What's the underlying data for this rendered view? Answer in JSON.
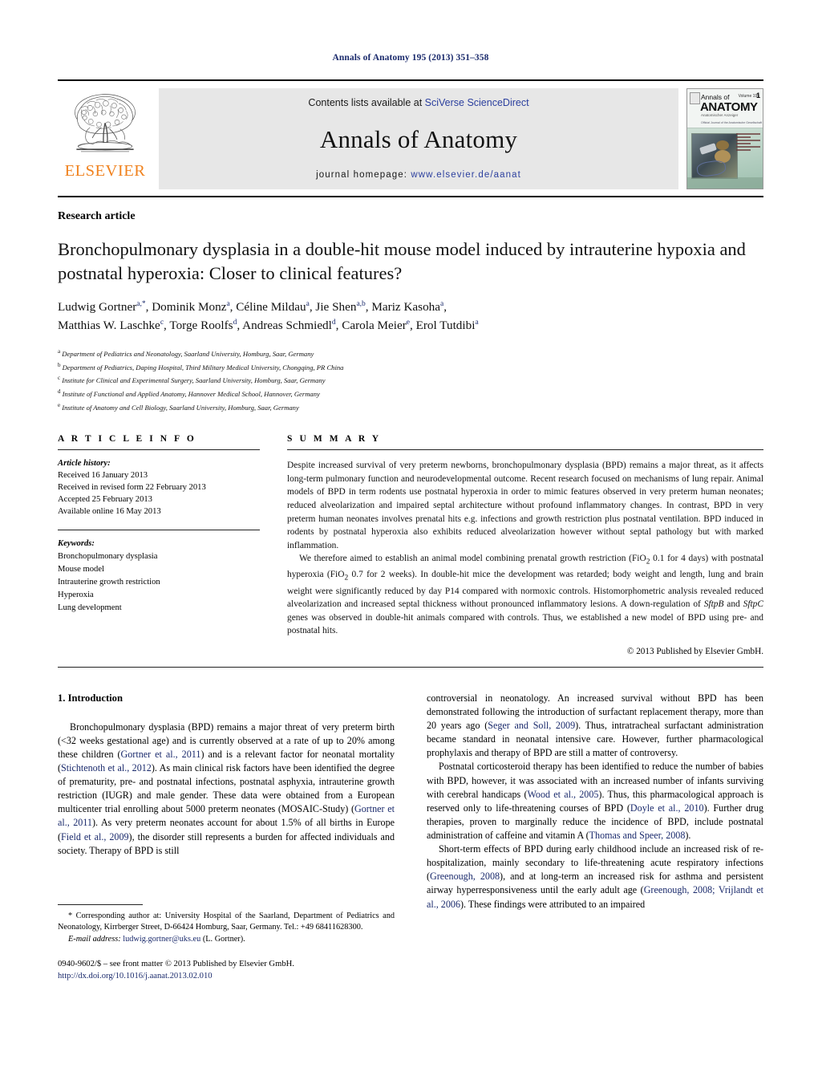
{
  "running_head": "Annals of Anatomy 195 (2013) 351–358",
  "masthead": {
    "publisher_logo_text": "ELSEVIER",
    "contents_prefix": "Contents lists available at ",
    "contents_link": "SciVerse ScienceDirect",
    "journal_title": "Annals of Anatomy",
    "homepage_label": "journal homepage: ",
    "homepage_url": "www.elsevier.de/aanat",
    "cover": {
      "line_annals": "Annals of",
      "line_anatomy": "ANATOMY",
      "volume_label": "Volume 195",
      "issue_number": "1",
      "subtitle": "Anatomischer Anzeiger",
      "tagline": "Official Journal of the Anatomische Gesellschaft"
    }
  },
  "article": {
    "type": "Research article",
    "title": "Bronchopulmonary dysplasia in a double-hit mouse model induced by intrauterine hypoxia and postnatal hyperoxia: Closer to clinical features?",
    "authors_line1": "Ludwig Gortner",
    "authors": "Ludwig Gortner a,*, Dominik Monz a, Céline Mildau a, Jie Shen a,b, Mariz Kasoha a, Matthias W. Laschke c, Torge Roolfs d, Andreas Schmiedl d, Carola Meier e, Erol Tutdibi a",
    "affiliations": [
      {
        "marker": "a",
        "text": "Department of Pediatrics and Neonatology, Saarland University, Homburg, Saar, Germany"
      },
      {
        "marker": "b",
        "text": "Department of Pediatrics, Daping Hospital, Third Military Medical University, Chongqing, PR China"
      },
      {
        "marker": "c",
        "text": "Institute for Clinical and Experimental Surgery, Saarland University, Homburg, Saar, Germany"
      },
      {
        "marker": "d",
        "text": "Institute of Functional and Applied Anatomy, Hannover Medical School, Hannover, Germany"
      },
      {
        "marker": "e",
        "text": "Institute of Anatomy and Cell Biology, Saarland University, Homburg, Saar, Germany"
      }
    ]
  },
  "article_info": {
    "heading": "A R T I C L E   I N F O",
    "history_label": "Article history:",
    "history": [
      "Received 16 January 2013",
      "Received in revised form 22 February 2013",
      "Accepted 25 February 2013",
      "Available online 16 May 2013"
    ],
    "keywords_label": "Keywords:",
    "keywords": [
      "Bronchopulmonary dysplasia",
      "Mouse model",
      "Intrauterine growth restriction",
      "Hyperoxia",
      "Lung development"
    ]
  },
  "summary": {
    "heading": "S U M M A R Y",
    "paragraph1": "Despite increased survival of very preterm newborns, bronchopulmonary dysplasia (BPD) remains a major threat, as it affects long-term pulmonary function and neurodevelopmental outcome. Recent research focused on mechanisms of lung repair. Animal models of BPD in term rodents use postnatal hyperoxia in order to mimic features observed in very preterm human neonates; reduced alveolarization and impaired septal architecture without profound inflammatory changes. In contrast, BPD in very preterm human neonates involves prenatal hits e.g. infections and growth restriction plus postnatal ventilation. BPD induced in rodents by postnatal hyperoxia also exhibits reduced alveolarization however without septal pathology but with marked inflammation.",
    "paragraph2": "We therefore aimed to establish an animal model combining prenatal growth restriction (FiO2 0.1 for 4 days) with postnatal hyperoxia (FiO2 0.7 for 2 weeks). In double-hit mice the development was retarded; body weight and length, lung and brain weight were significantly reduced by day P14 compared with normoxic controls. Histomorphometric analysis revealed reduced alveolarization and increased septal thickness without pronounced inflammatory lesions. A down-regulation of SftpB and SftpC genes was observed in double-hit animals compared with controls. Thus, we established a new model of BPD using pre- and postnatal hits.",
    "copyright": "© 2013 Published by Elsevier GmbH."
  },
  "body": {
    "section_number_title": "1.  Introduction",
    "left_paragraph": "Bronchopulmonary dysplasia (BPD) remains a major threat of very preterm birth (<32 weeks gestational age) and is currently observed at a rate of up to 20% among these children (Gortner et al., 2011) and is a relevant factor for neonatal mortality (Stichtenoth et al., 2012). As main clinical risk factors have been identified the degree of prematurity, pre- and postnatal infections, postnatal asphyxia, intrauterine growth restriction (IUGR) and male gender. These data were obtained from a European multicenter trial enrolling about 5000 preterm neonates (MOSAIC-Study) (Gortner et al., 2011). As very preterm neonates account for about 1.5% of all births in Europe (Field et al., 2009), the disorder still represents a burden for affected individuals and society. Therapy of BPD is still",
    "right_paragraph1": "controversial in neonatology. An increased survival without BPD has been demonstrated following the introduction of surfactant replacement therapy, more than 20 years ago (Seger and Soll, 2009). Thus, intratracheal surfactant administration became standard in neonatal intensive care. However, further pharmacological prophylaxis and therapy of BPD are still a matter of controversy.",
    "right_paragraph2": "Postnatal corticosteroid therapy has been identified to reduce the number of babies with BPD, however, it was associated with an increased number of infants surviving with cerebral handicaps (Wood et al., 2005). Thus, this pharmacological approach is reserved only to life-threatening courses of BPD (Doyle et al., 2010). Further drug therapies, proven to marginally reduce the incidence of BPD, include postnatal administration of caffeine and vitamin A (Thomas and Speer, 2008).",
    "right_paragraph3": "Short-term effects of BPD during early childhood include an increased risk of re-hospitalization, mainly secondary to life-threatening acute respiratory infections (Greenough, 2008), and at long-term an increased risk for asthma and persistent airway hyperresponsiveness until the early adult age (Greenough, 2008; Vrijlandt et al., 2006). These findings were attributed to an impaired"
  },
  "footnote": {
    "corresponding": "* Corresponding author at: University Hospital of the Saarland, Department of Pediatrics and Neonatology, Kirrberger Street, D-66424 Homburg, Saar, Germany. Tel.: +49 68411628300.",
    "email_label": "E-mail address:",
    "email": "ludwig.gortner@uks.eu",
    "email_suffix": "(L. Gortner)."
  },
  "imprint": {
    "issn_line": "0940-9602/$ – see front matter © 2013 Published by Elsevier GmbH.",
    "doi": "http://dx.doi.org/10.1016/j.aanat.2013.02.010"
  },
  "colors": {
    "link_blue": "#1a2a6c",
    "elsevier_orange": "#f0821e",
    "band_grey": "#e7e7e7"
  }
}
